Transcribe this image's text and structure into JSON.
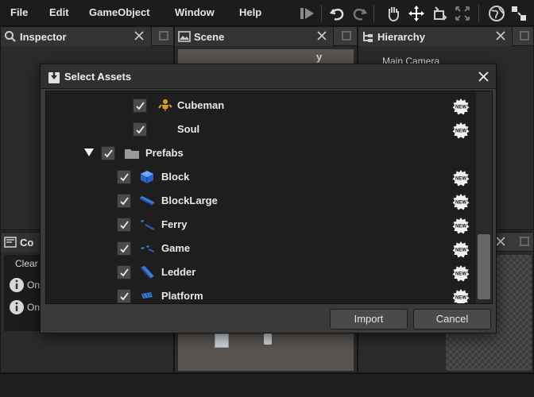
{
  "menubar": {
    "items": [
      "File",
      "Edit",
      "GameObject",
      "Window",
      "Help"
    ]
  },
  "toolbar": {
    "icons": [
      "step-play-icon",
      "undo-icon",
      "redo-icon",
      "hand-icon",
      "move-icon",
      "rotate-icon",
      "scale-icon",
      "globe-icon",
      "layout-icon"
    ]
  },
  "panels": {
    "inspector": {
      "title": "Inspector"
    },
    "scene": {
      "title": "Scene",
      "axis_label": "y"
    },
    "hierarchy": {
      "title": "Hierarchy",
      "items": [
        "Main Camera"
      ]
    },
    "console": {
      "title": "Co",
      "clear_label": "Clear",
      "messages": [
        "On",
        "On"
      ]
    }
  },
  "dialog": {
    "title": "Select Assets",
    "rows": [
      {
        "label": "Cubeman",
        "icon": "character-icon",
        "checked": true,
        "badge": "NEW"
      },
      {
        "label": "Soul",
        "icon": "none",
        "checked": true,
        "badge": "NEW"
      },
      {
        "label": "Prefabs",
        "icon": "folder-icon",
        "checked": true,
        "expanded": true
      },
      {
        "label": "Block",
        "icon": "cube-icon",
        "checked": true,
        "badge": "NEW"
      },
      {
        "label": "BlockLarge",
        "icon": "prefab-icon",
        "checked": true,
        "badge": "NEW"
      },
      {
        "label": "Ferry",
        "icon": "prefab-icon",
        "checked": true,
        "badge": "NEW"
      },
      {
        "label": "Game",
        "icon": "prefab-icon",
        "checked": true,
        "badge": "NEW"
      },
      {
        "label": "Ledder",
        "icon": "prefab-icon",
        "checked": true,
        "badge": "NEW"
      },
      {
        "label": "Platform",
        "icon": "prefab-icon",
        "checked": true,
        "badge": "NEW"
      }
    ],
    "import_label": "Import",
    "cancel_label": "Cancel"
  },
  "colors": {
    "background": "#262626",
    "panel": "#2b2b2b",
    "prefab_blue": "#3a7bd5",
    "character_orange": "#d89a2a"
  }
}
